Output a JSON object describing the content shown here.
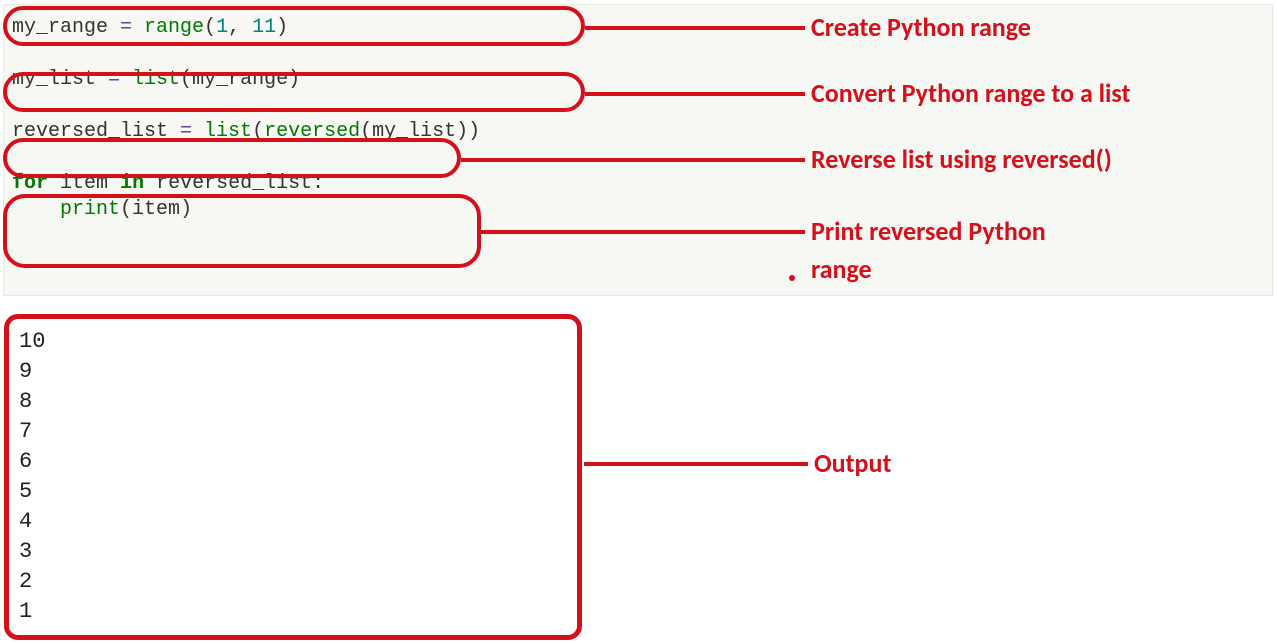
{
  "code": {
    "line1": {
      "var": "my_range",
      "eq": " = ",
      "fn": "range",
      "open": "(",
      "arg1": "1",
      "comma": ", ",
      "arg2": "11",
      "close": ")"
    },
    "line2": {
      "var": "my_list",
      "eq": " = ",
      "fn": "list",
      "open": "(",
      "arg": "my_range",
      "close": ")"
    },
    "line3": {
      "var": "reversed_list",
      "eq": " = ",
      "fn1": "list",
      "open1": "(",
      "fn2": "reversed",
      "open2": "(",
      "arg": "my_list",
      "close": "))"
    },
    "line4": {
      "for": "for",
      "sp1": " ",
      "item": "item",
      "sp2": " ",
      "in": "in",
      "sp3": " ",
      "iter": "reversed_list",
      "colon": ":"
    },
    "line5": {
      "indent": "    ",
      "fn": "print",
      "open": "(",
      "arg": "item",
      "close": ")"
    }
  },
  "annotations": {
    "a1": "Create Python range",
    "a2": "Convert Python range to a list",
    "a3": "Reverse list using reversed()",
    "a4_l1": "Print reversed Python",
    "a4_l2": "range",
    "output": "Output"
  },
  "output_lines": [
    "10",
    "9",
    "8",
    "7",
    "6",
    "5",
    "4",
    "3",
    "2",
    "1"
  ]
}
